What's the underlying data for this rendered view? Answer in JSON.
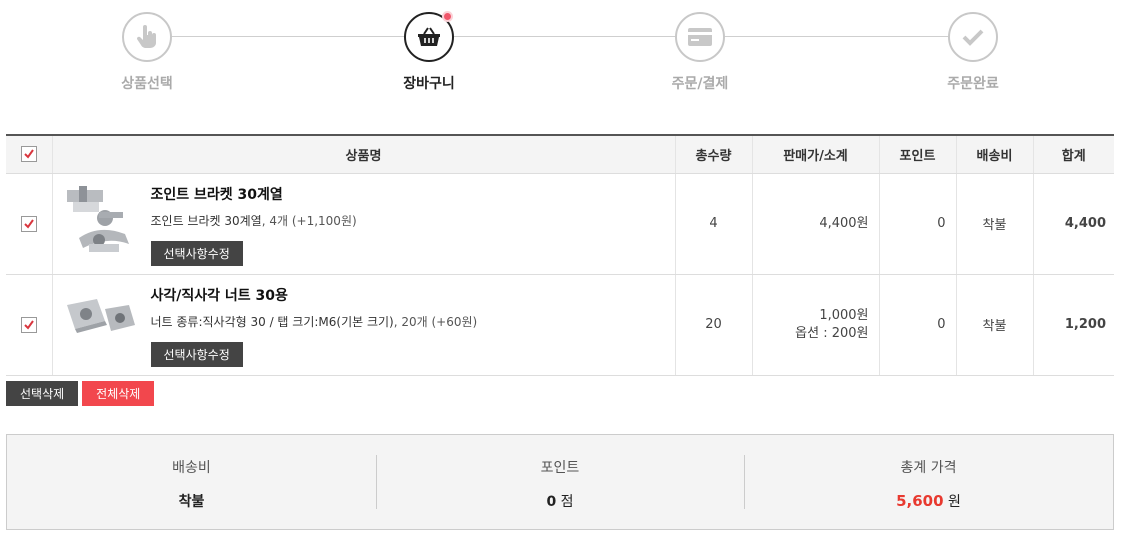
{
  "steps": [
    {
      "label": "상품선택",
      "icon": "hand-pointer-icon"
    },
    {
      "label": "장바구니",
      "icon": "basket-icon"
    },
    {
      "label": "주문/결제",
      "icon": "credit-card-icon"
    },
    {
      "label": "주문완료",
      "icon": "checkmark-icon"
    }
  ],
  "table": {
    "headers": {
      "product": "상품명",
      "qty": "총수량",
      "price": "판매가/소계",
      "point": "포인트",
      "shipping": "배송비",
      "total": "합계"
    },
    "rows": [
      {
        "name": "조인트 브라켓 30계열",
        "option_main": "조인트 브라켓 30계열",
        "option_extra": ", 4개 (+1,100원)",
        "edit_label": "선택사항수정",
        "qty": "4",
        "price": "4,400원",
        "price_extra": "",
        "point": "0",
        "shipping": "착불",
        "total": "4,400"
      },
      {
        "name": "사각/직사각 너트 30용",
        "option_main": "너트 종류:직사각형 30 / 탭 크기:M6(기본 크기)",
        "option_extra": ", 20개 (+60원)",
        "edit_label": "선택사항수정",
        "qty": "20",
        "price": "1,000원",
        "price_extra": "옵션 : 200원",
        "point": "0",
        "shipping": "착불",
        "total": "1,200"
      }
    ]
  },
  "actions": {
    "delete_selected": "선택삭제",
    "delete_all": "전체삭제"
  },
  "summary": {
    "shipping_label": "배송비",
    "shipping_value": "착불",
    "point_label": "포인트",
    "point_value": "0",
    "point_unit": "점",
    "total_label": "총계 가격",
    "total_value": "5,600",
    "total_unit": "원"
  },
  "colors": {
    "accent_red": "#e8392f",
    "delete_all_bg": "#f2474d",
    "dark_button": "#444444",
    "checkbox_red": "#d9363e"
  }
}
